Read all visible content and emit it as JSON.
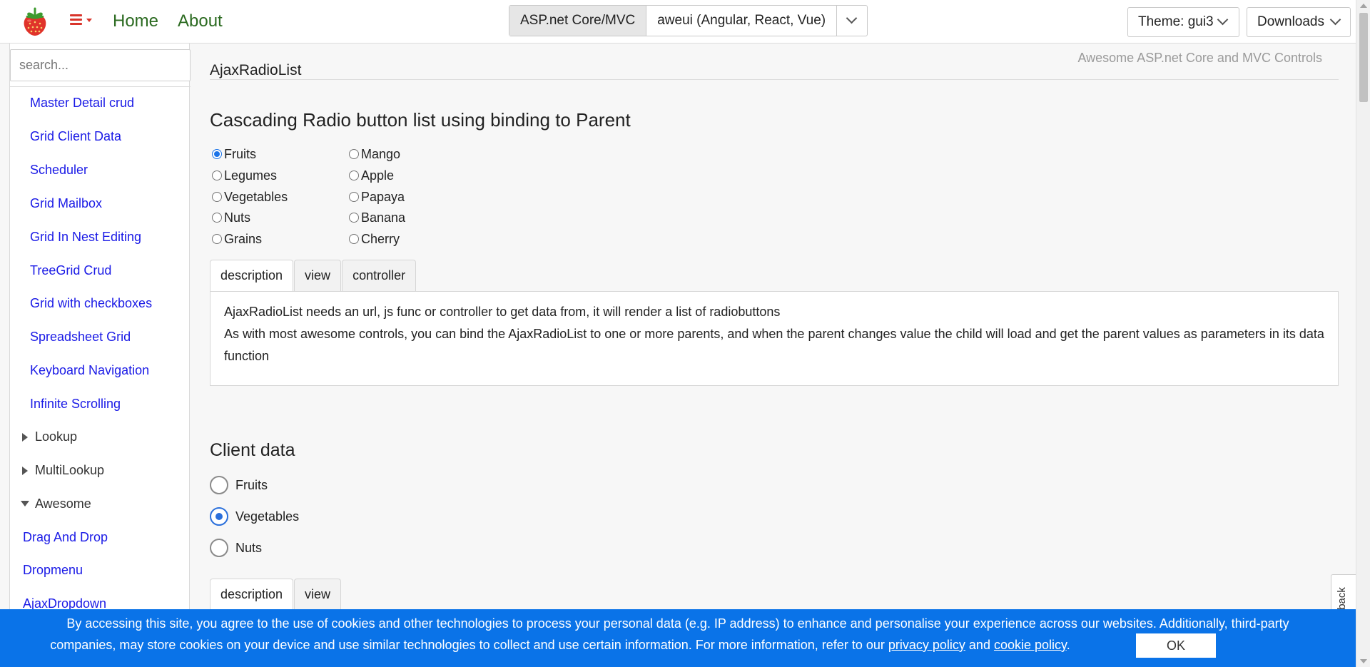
{
  "nav": {
    "home": "Home",
    "about": "About",
    "platform_active": "ASP.net Core/MVC",
    "platform_other": "aweui (Angular, React, Vue)",
    "theme": "Theme: gui3",
    "downloads": "Downloads"
  },
  "sidebar": {
    "search_placeholder": "search...",
    "items": [
      {
        "label": "Master Detail crud"
      },
      {
        "label": "Grid Client Data"
      },
      {
        "label": "Scheduler"
      },
      {
        "label": "Grid Mailbox"
      },
      {
        "label": "Grid In Nest Editing"
      },
      {
        "label": "TreeGrid Crud"
      },
      {
        "label": "Grid with checkboxes"
      },
      {
        "label": "Spreadsheet Grid"
      },
      {
        "label": "Keyboard Navigation"
      },
      {
        "label": "Infinite Scrolling"
      },
      {
        "label": "Lookup"
      },
      {
        "label": "MultiLookup"
      },
      {
        "label": "Awesome"
      },
      {
        "label": "Drag And Drop"
      },
      {
        "label": "Dropmenu"
      },
      {
        "label": "AjaxDropdown"
      }
    ]
  },
  "main": {
    "tagline": "Awesome ASP.net Core and MVC Controls",
    "page_title": "AjaxRadioList",
    "section1": {
      "heading": "Cascading Radio button list using binding to Parent",
      "parent_options": [
        "Fruits",
        "Legumes",
        "Vegetables",
        "Nuts",
        "Grains"
      ],
      "parent_selected": "Fruits",
      "child_options": [
        "Mango",
        "Apple",
        "Papaya",
        "Banana",
        "Cherry"
      ],
      "tabs": [
        "description",
        "view",
        "controller"
      ],
      "description_line1": "AjaxRadioList needs an url, js func or controller to get data from, it will render a list of radiobuttons",
      "description_line2": "As with most awesome controls, you can bind the AjaxRadioList to one or more parents, and when the parent changes value the child will load and get the parent values as parameters in its data function"
    },
    "section2": {
      "heading": "Client data",
      "options": [
        "Fruits",
        "Vegetables",
        "Nuts"
      ],
      "selected": "Vegetables",
      "tabs": [
        "description",
        "view"
      ]
    }
  },
  "cookie": {
    "line1": "By accessing this site, you agree to the use of cookies and other technologies to process your personal data (e.g. IP address) to enhance and personalise your experience across our websites. Additionally, third-party",
    "line2_text": "companies, may store cookies on your device and use similar technologies to collect and use certain information. For more information, refer to our",
    "privacy_link": "privacy policy",
    "and": "and",
    "cookie_link": "cookie policy",
    "period": ".",
    "ok": "OK"
  },
  "feedback": "feedback",
  "colors": {
    "accent": "#1a73e8",
    "cookie_bar": "#0a73e8",
    "link": "#1a1ae6",
    "nav_link": "#2b6a20",
    "menu_icon": "#d9342b"
  }
}
